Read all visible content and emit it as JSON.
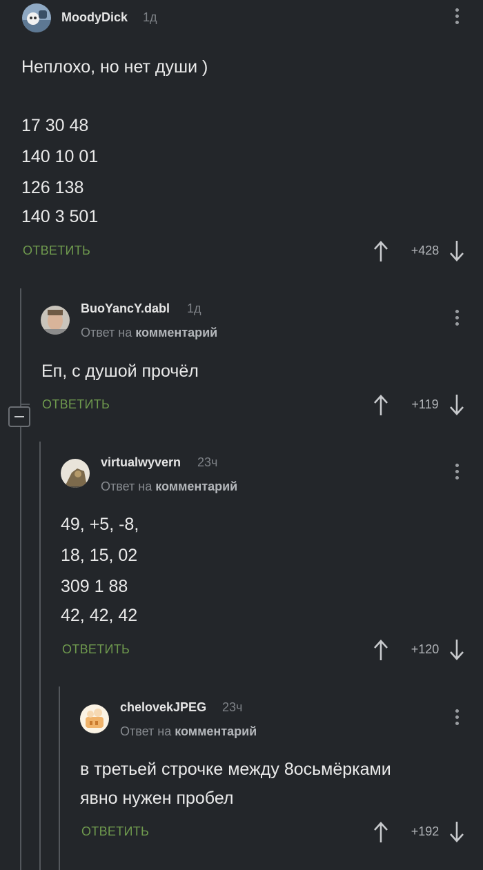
{
  "comments": [
    {
      "username": "MoodyDick",
      "time": "1д",
      "lines": [
        "Неплохо, но нет души )",
        "17 30 48",
        "140 10 01",
        "126 138",
        "140 3 501"
      ],
      "reply_label": "ОТВЕТИТЬ",
      "score": "+428"
    },
    {
      "username": "BuoYancY.dabl",
      "time": "1д",
      "reply_prefix": "Ответ на",
      "reply_target": "комментарий",
      "lines": [
        "Еп, с душой прочёл"
      ],
      "reply_label": "ОТВЕТИТЬ",
      "score": "+119"
    },
    {
      "username": "virtualwyvern",
      "time": "23ч",
      "reply_prefix": "Ответ на",
      "reply_target": "комментарий",
      "lines": [
        "49, +5, -8,",
        "18, 15, 02",
        "309 1 88",
        "42, 42, 42"
      ],
      "reply_label": "ОТВЕТИТЬ",
      "score": "+120"
    },
    {
      "username": "chelovekJPEG",
      "time": "23ч",
      "reply_prefix": "Ответ на",
      "reply_target": "комментарий",
      "lines": [
        "в третьей строчке между 8осьмёрками",
        "явно нужен пробел"
      ],
      "reply_label": "ОТВЕТИТЬ",
      "score": "+192"
    }
  ],
  "colors": {
    "background": "#23262a",
    "reply_green": "#6f9a4e",
    "thread_line": "#53575c"
  }
}
